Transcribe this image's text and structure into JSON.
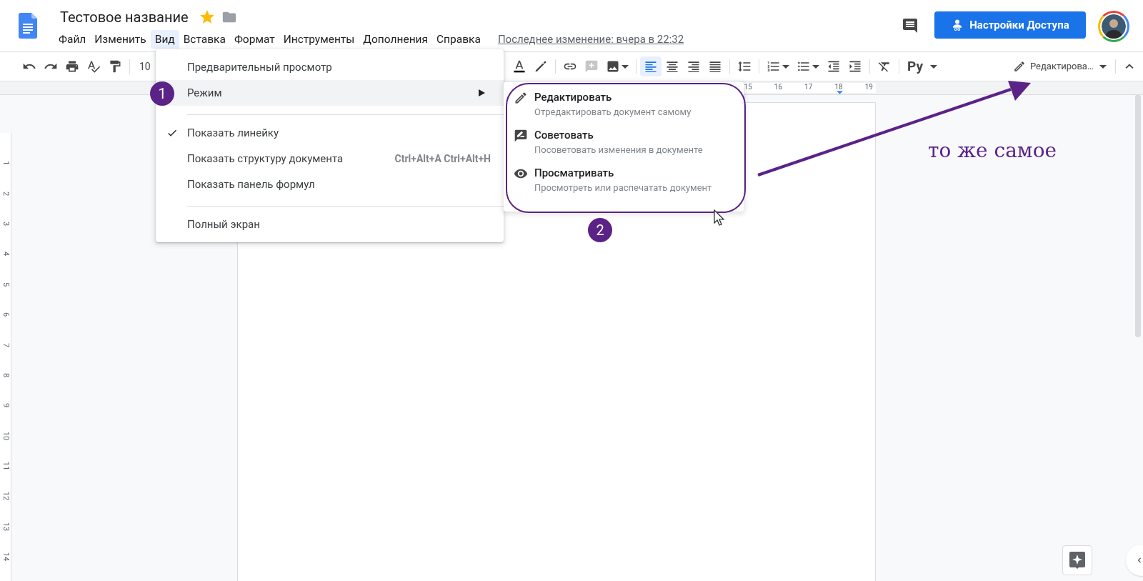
{
  "doc": {
    "title": "Тестовое название",
    "starred": true
  },
  "menubar": [
    {
      "label": "Файл",
      "selected": false
    },
    {
      "label": "Изменить",
      "selected": false
    },
    {
      "label": "Вид",
      "selected": true
    },
    {
      "label": "Вставка",
      "selected": false
    },
    {
      "label": "Формат",
      "selected": false
    },
    {
      "label": "Инструменты",
      "selected": false
    },
    {
      "label": "Дополнения",
      "selected": false
    },
    {
      "label": "Справка",
      "selected": false
    }
  ],
  "last_edit": "Последнее изменение: вчера в 22:32",
  "share_button": "Настройки Доступа",
  "toolbar": {
    "left_tools": [
      {
        "kind": "undo",
        "selected": false,
        "dropdown": false
      },
      {
        "kind": "redo",
        "selected": false,
        "dropdown": false
      },
      {
        "kind": "print",
        "selected": false,
        "dropdown": false
      },
      {
        "kind": "spellcheck",
        "selected": false,
        "dropdown": false
      },
      {
        "kind": "paint_format",
        "selected": false,
        "dropdown": false
      }
    ],
    "zoom": "10",
    "groups": [
      [
        {
          "kind": "text_color",
          "selected": false,
          "dropdown": false
        },
        {
          "kind": "highlight",
          "selected": false,
          "dropdown": false
        }
      ],
      [
        {
          "kind": "link",
          "selected": false,
          "dropdown": false
        },
        {
          "kind": "add_comment",
          "selected": false,
          "dropdown": false
        },
        {
          "kind": "image",
          "selected": false,
          "dropdown": true
        }
      ],
      [
        {
          "kind": "align_left",
          "selected": true,
          "dropdown": false
        },
        {
          "kind": "align_center",
          "selected": false,
          "dropdown": false
        },
        {
          "kind": "align_right",
          "selected": false,
          "dropdown": false
        },
        {
          "kind": "align_justify",
          "selected": false,
          "dropdown": false
        }
      ],
      [
        {
          "kind": "line_spacing",
          "selected": false,
          "dropdown": false
        }
      ],
      [
        {
          "kind": "numbered_list",
          "selected": false,
          "dropdown": true
        },
        {
          "kind": "bulleted_list",
          "selected": false,
          "dropdown": true
        },
        {
          "kind": "outdent",
          "selected": false,
          "dropdown": false
        },
        {
          "kind": "indent",
          "selected": false,
          "dropdown": false
        }
      ],
      [
        {
          "kind": "clear_format",
          "selected": false,
          "dropdown": false
        }
      ]
    ],
    "input_language": "Ру",
    "mode": "Редактирова…"
  },
  "ruler": [
    "15",
    "16",
    "17",
    "18",
    "19"
  ],
  "vertical_ruler": [
    "1",
    "2",
    "3",
    "4",
    "5",
    "6",
    "7",
    "8",
    "9",
    "10",
    "11",
    "12",
    "13",
    "14"
  ],
  "view_menu": [
    {
      "kind": "item",
      "label": "Предварительный просмотр",
      "checked": false
    },
    {
      "kind": "submenu",
      "label": "Режим",
      "selected": true
    },
    {
      "kind": "divider"
    },
    {
      "kind": "item",
      "label": "Показать линейку",
      "checked": true
    },
    {
      "kind": "item",
      "label": "Показать структуру документа",
      "shortcut": "Ctrl+Alt+A Ctrl+Alt+H",
      "checked": false
    },
    {
      "kind": "item",
      "label": "Показать панель формул",
      "checked": false
    },
    {
      "kind": "divider"
    },
    {
      "kind": "item",
      "label": "Полный экран",
      "checked": false
    }
  ],
  "mode_menu": [
    {
      "kind": "edit",
      "title": "Редактировать",
      "description": "Отредактировать документ самому"
    },
    {
      "kind": "suggest",
      "title": "Советовать",
      "description": "Посоветовать изменения в документе"
    },
    {
      "kind": "view",
      "title": "Просматривать",
      "description": "Просмотреть или распечатать документ"
    }
  ],
  "annotations": {
    "step_badges": [
      "1",
      "2"
    ],
    "note": "то же самое"
  }
}
